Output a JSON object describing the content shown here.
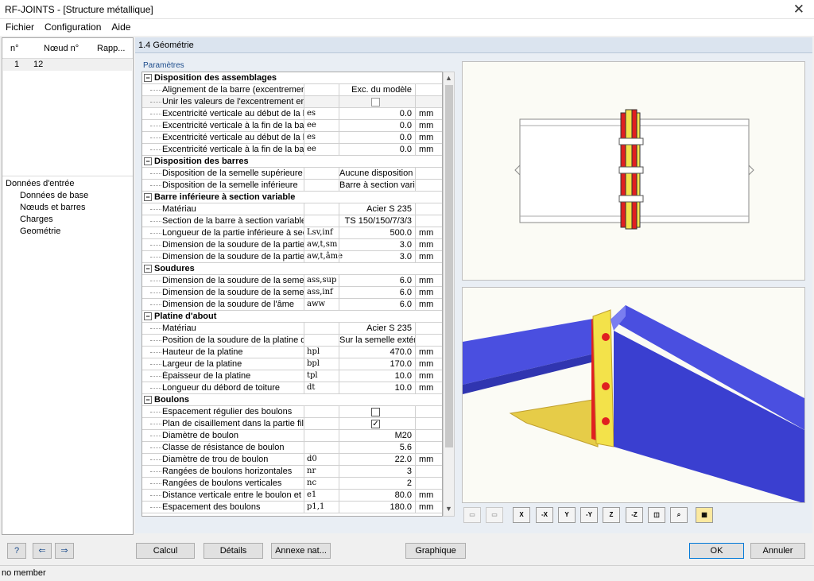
{
  "window": {
    "title": "RF-JOINTS - [Structure métallique]"
  },
  "menu": [
    "Fichier",
    "Configuration",
    "Aide"
  ],
  "left_table": {
    "headers": [
      "n°",
      "Nœud n°",
      "Rapp..."
    ],
    "rows": [
      [
        "1",
        "12",
        ""
      ]
    ]
  },
  "tree": {
    "root": "Données d'entrée",
    "items": [
      "Données de base",
      "Nœuds et barres",
      "Charges",
      "Geométrie"
    ]
  },
  "section_title": "1.4 Géométrie",
  "params_label": "Paramètres",
  "grid": [
    {
      "group": "Disposition des assemblages"
    },
    {
      "name": "Alignement de la barre (excentrement d",
      "sym": "",
      "val": "Exc. du modèle",
      "unit": ""
    },
    {
      "name": "Unir les valeurs de l'excentrement ense",
      "sym": "",
      "check": "dim",
      "unit": ""
    },
    {
      "name": "Excentricité verticale au début de la ba",
      "sym": "es",
      "val": "0.0",
      "unit": "mm"
    },
    {
      "name": "Excentricité verticale à la fin de la barre",
      "sym": "ee",
      "val": "0.0",
      "unit": "mm"
    },
    {
      "name": "Excentricité verticale au début de la ba",
      "sym": "es",
      "val": "0.0",
      "unit": "mm"
    },
    {
      "name": "Excentricité verticale à la fin de la barre",
      "sym": "ee",
      "val": "0.0",
      "unit": "mm"
    },
    {
      "group": "Disposition des barres"
    },
    {
      "name": "Disposition de la semelle supérieure",
      "sym": "",
      "val": "Aucune disposition",
      "unit": ""
    },
    {
      "name": "Disposition de la semelle inférieure",
      "sym": "",
      "val": "Barre à section vari",
      "unit": ""
    },
    {
      "group": "Barre inférieure à section variable"
    },
    {
      "name": "Matériau",
      "sym": "",
      "val": "Acier S 235",
      "unit": ""
    },
    {
      "name": "Section de la barre à section variable",
      "sym": "",
      "val": "TS 150/150/7/3/3",
      "unit": ""
    },
    {
      "name": "Longueur de la partie inférieure à sectic",
      "sym": "Lsv,inf",
      "val": "500.0",
      "unit": "mm"
    },
    {
      "name": "Dimension de la soudure de la partie de",
      "sym": "aw,t,sm",
      "val": "3.0",
      "unit": "mm"
    },
    {
      "name": "Dimension de la soudure de la partie de",
      "sym": "aw,t,âme",
      "val": "3.0",
      "unit": "mm"
    },
    {
      "group": "Soudures"
    },
    {
      "name": "Dimension de la soudure de la semelle",
      "sym": "ass,sup",
      "val": "6.0",
      "unit": "mm"
    },
    {
      "name": "Dimension de la soudure de la semelle",
      "sym": "ass,inf",
      "val": "6.0",
      "unit": "mm"
    },
    {
      "name": "Dimension de la soudure de l'âme",
      "sym": "aww",
      "val": "6.0",
      "unit": "mm"
    },
    {
      "group": "Platine d'about"
    },
    {
      "name": "Matériau",
      "sym": "",
      "val": "Acier S 235",
      "unit": ""
    },
    {
      "name": "Position de la soudure de la platine d'al",
      "sym": "",
      "val": "Sur la semelle extéri",
      "unit": ""
    },
    {
      "name": "Hauteur de la platine",
      "sym": "hpl",
      "val": "470.0",
      "unit": "mm"
    },
    {
      "name": "Largeur de la platine",
      "sym": "bpl",
      "val": "170.0",
      "unit": "mm"
    },
    {
      "name": "Épaisseur de la platine",
      "sym": "tpl",
      "val": "10.0",
      "unit": "mm"
    },
    {
      "name": "Longueur du débord de toiture",
      "sym": "dt",
      "val": "10.0",
      "unit": "mm"
    },
    {
      "group": "Boulons"
    },
    {
      "name": "Espacement régulier des boulons",
      "sym": "",
      "check": "off",
      "unit": ""
    },
    {
      "name": "Plan de cisaillement dans la partie fileté",
      "sym": "",
      "check": "on",
      "unit": ""
    },
    {
      "name": "Diamètre de boulon",
      "sym": "",
      "val": "M20",
      "unit": ""
    },
    {
      "name": "Classe de résistance de boulon",
      "sym": "",
      "val": "5.6",
      "unit": ""
    },
    {
      "name": "Diamètre de trou de boulon",
      "sym": "d0",
      "val": "22.0",
      "unit": "mm"
    },
    {
      "name": "Rangées de boulons horizontales",
      "sym": "nr",
      "val": "3",
      "unit": ""
    },
    {
      "name": "Rangées de boulons verticales",
      "sym": "nc",
      "val": "2",
      "unit": ""
    },
    {
      "name": "Distance verticale entre le boulon et le",
      "sym": "e1",
      "val": "80.0",
      "unit": "mm"
    },
    {
      "name": "Espacement des boulons",
      "sym": "p1,1",
      "val": "180.0",
      "unit": "mm"
    }
  ],
  "view_toolbar": [
    "X",
    "-X",
    "Y",
    "-Y",
    "Z",
    "-Z"
  ],
  "buttons": {
    "calcul": "Calcul",
    "details": "Détails",
    "annexe": "Annexe nat...",
    "graphique": "Graphique",
    "ok": "OK",
    "annuler": "Annuler"
  },
  "status": "no member",
  "colors": {
    "beam": "#4a4fe0",
    "plate": "#f3e24a",
    "weld": "#e02020"
  }
}
